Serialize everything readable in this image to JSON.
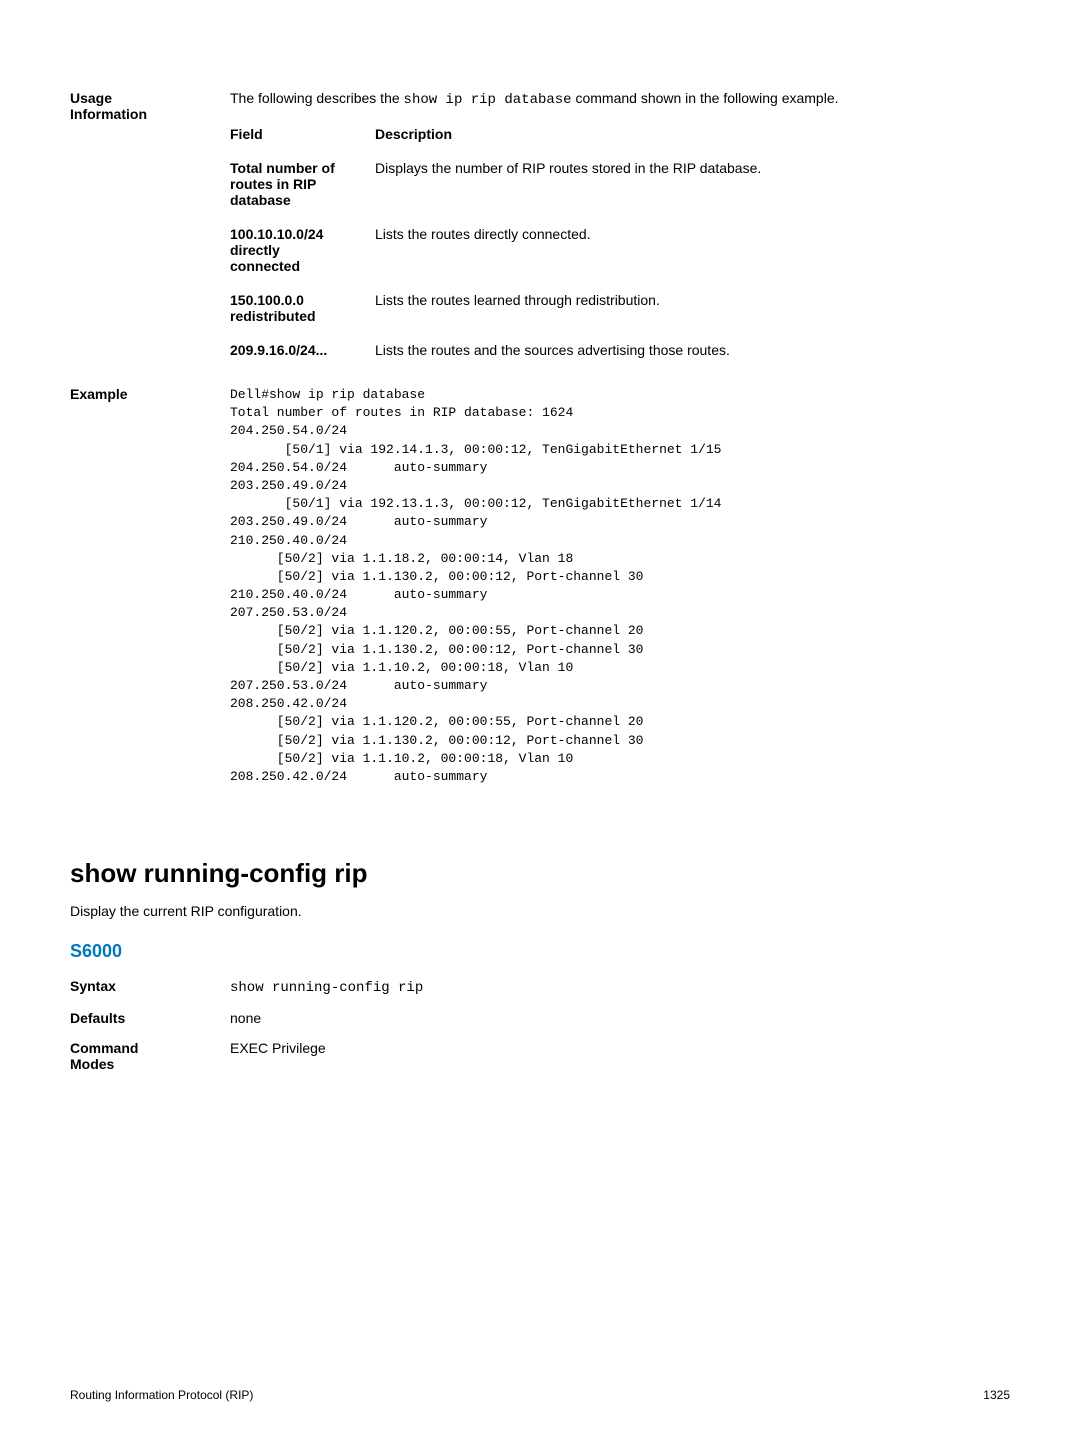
{
  "usage": {
    "label1": "Usage",
    "label2": "Information",
    "intro_a": "The following describes the ",
    "intro_code": "show ip rip database",
    "intro_b": " command shown in the following example.",
    "header_field": "Field",
    "header_desc": "Description",
    "rows": [
      {
        "label_a": "Total number of",
        "label_b": "routes in RIP",
        "label_c": "database",
        "desc": "Displays the number of RIP routes stored in the RIP database."
      },
      {
        "label_a": "100.10.10.0/24",
        "label_b": "directly",
        "label_c": "connected",
        "desc": "Lists the routes directly connected."
      },
      {
        "label_a": "150.100.0.0",
        "label_b": "redistributed",
        "desc": "Lists the routes learned through redistribution."
      },
      {
        "label_a": "209.9.16.0/24...",
        "desc": "Lists the routes and the sources advertising those routes."
      }
    ]
  },
  "example": {
    "label": "Example",
    "output": "Dell#show ip rip database\nTotal number of routes in RIP database: 1624\n204.250.54.0/24\n       [50/1] via 192.14.1.3, 00:00:12, TenGigabitEthernet 1/15\n204.250.54.0/24      auto-summary\n203.250.49.0/24\n       [50/1] via 192.13.1.3, 00:00:12, TenGigabitEthernet 1/14\n203.250.49.0/24      auto-summary\n210.250.40.0/24\n      [50/2] via 1.1.18.2, 00:00:14, Vlan 18\n      [50/2] via 1.1.130.2, 00:00:12, Port-channel 30\n210.250.40.0/24      auto-summary\n207.250.53.0/24\n      [50/2] via 1.1.120.2, 00:00:55, Port-channel 20\n      [50/2] via 1.1.130.2, 00:00:12, Port-channel 30\n      [50/2] via 1.1.10.2, 00:00:18, Vlan 10\n207.250.53.0/24      auto-summary\n208.250.42.0/24\n      [50/2] via 1.1.120.2, 00:00:55, Port-channel 20\n      [50/2] via 1.1.130.2, 00:00:12, Port-channel 30\n      [50/2] via 1.1.10.2, 00:00:18, Vlan 10\n208.250.42.0/24      auto-summary"
  },
  "section": {
    "title": "show running-config rip",
    "intro": "Display the current RIP configuration.",
    "subsection": "S6000",
    "rows": {
      "syntax_label": "Syntax",
      "syntax_value": "show running-config rip",
      "defaults_label": "Defaults",
      "defaults_value": "none",
      "command_label_a": "Command",
      "command_label_b": "Modes",
      "command_value": "EXEC Privilege"
    }
  },
  "footer": {
    "left": "Routing Information Protocol (RIP)",
    "right": "1325"
  }
}
